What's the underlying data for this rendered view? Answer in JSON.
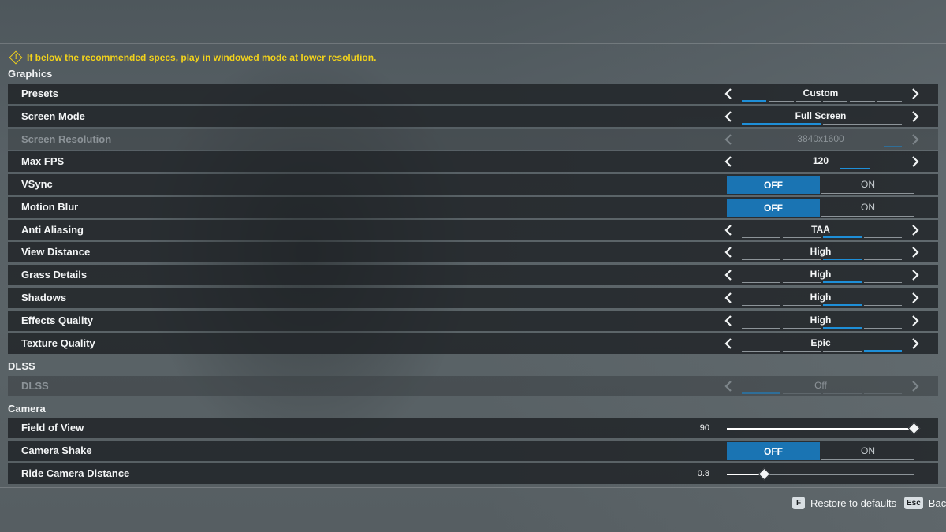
{
  "warning": {
    "text": "If below the recommended specs, play in windowed mode at lower resolution.",
    "icon": "warning-diamond-icon",
    "color": "#f2d21b"
  },
  "sections": {
    "graphics": "Graphics",
    "dlss": "DLSS",
    "camera": "Camera"
  },
  "colors": {
    "accent": "#1a74b3",
    "segment_active": "#1e8fd8"
  },
  "settings": {
    "presets": {
      "label": "Presets",
      "value": "Custom",
      "segments": 6,
      "active_segment": 1
    },
    "screen_mode": {
      "label": "Screen Mode",
      "value": "Full Screen",
      "segments": 2,
      "active_segment": 1
    },
    "screen_resolution": {
      "label": "Screen Resolution",
      "value": "3840x1600",
      "segments": 8,
      "active_segment": 8,
      "disabled": true
    },
    "max_fps": {
      "label": "Max FPS",
      "value": "120",
      "segments": 5,
      "active_segment": 4
    },
    "vsync": {
      "label": "VSync",
      "off": "OFF",
      "on": "ON",
      "selected": "OFF"
    },
    "motion_blur": {
      "label": "Motion Blur",
      "off": "OFF",
      "on": "ON",
      "selected": "OFF"
    },
    "anti_aliasing": {
      "label": "Anti Aliasing",
      "value": "TAA",
      "segments": 4,
      "active_segment": 3
    },
    "view_distance": {
      "label": "View Distance",
      "value": "High",
      "segments": 4,
      "active_segment": 3
    },
    "grass_details": {
      "label": "Grass Details",
      "value": "High",
      "segments": 4,
      "active_segment": 3
    },
    "shadows": {
      "label": "Shadows",
      "value": "High",
      "segments": 4,
      "active_segment": 3
    },
    "effects_quality": {
      "label": "Effects Quality",
      "value": "High",
      "segments": 4,
      "active_segment": 3
    },
    "texture_quality": {
      "label": "Texture Quality",
      "value": "Epic",
      "segments": 4,
      "active_segment": 4
    },
    "dlss": {
      "label": "DLSS",
      "value": "Off",
      "segments": 4,
      "active_segment": 1,
      "disabled": true
    },
    "field_of_view": {
      "label": "Field of View",
      "value": "90",
      "fraction": 1.0
    },
    "camera_shake": {
      "label": "Camera Shake",
      "off": "OFF",
      "on": "ON",
      "selected": "OFF"
    },
    "ride_camera_distance": {
      "label": "Ride Camera Distance",
      "value": "0.8",
      "fraction": 0.2
    }
  },
  "footer": {
    "restore": {
      "key": "F",
      "label": "Restore to defaults"
    },
    "back": {
      "key": "Esc",
      "label": "Back"
    }
  }
}
